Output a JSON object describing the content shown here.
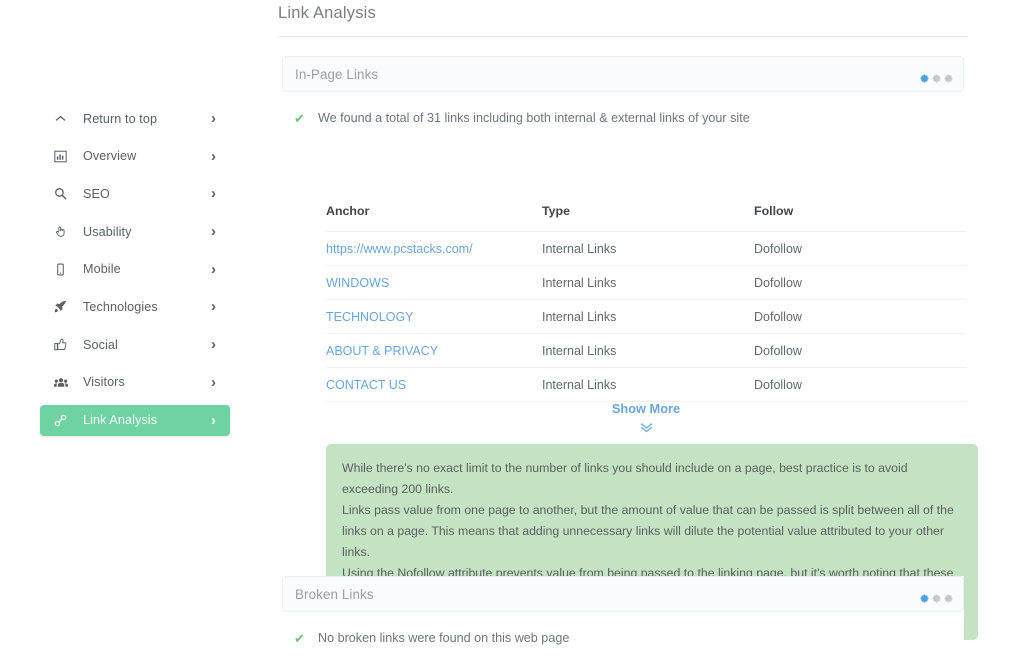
{
  "page": {
    "title": "Link Analysis"
  },
  "sidebar": {
    "items": [
      {
        "label": "Return to top",
        "icon": "chevron-up-icon",
        "key": "return-to-top",
        "active": false,
        "arrow": "›"
      },
      {
        "label": "Overview",
        "icon": "bar-chart-icon",
        "key": "overview",
        "active": false,
        "arrow": "›"
      },
      {
        "label": "SEO",
        "icon": "search-icon",
        "key": "seo",
        "active": false,
        "arrow": "›"
      },
      {
        "label": "Usability",
        "icon": "hand-pointer-icon",
        "key": "usability",
        "active": false,
        "arrow": "›"
      },
      {
        "label": "Mobile",
        "icon": "mobile-icon",
        "key": "mobile",
        "active": false,
        "arrow": "›"
      },
      {
        "label": "Technologies",
        "icon": "rocket-icon",
        "key": "technologies",
        "active": false,
        "arrow": "›"
      },
      {
        "label": "Social",
        "icon": "thumbs-up-icon",
        "key": "social",
        "active": false,
        "arrow": "›"
      },
      {
        "label": "Visitors",
        "icon": "users-icon",
        "key": "visitors",
        "active": false,
        "arrow": "›"
      },
      {
        "label": "Link Analysis",
        "icon": "chain-link-icon",
        "key": "link-analysis",
        "active": true,
        "arrow": "›"
      }
    ]
  },
  "inpage": {
    "header_title": "In-Page Links",
    "status_text": "We found a total of 31 links including both internal & external links of your site",
    "check_glyph": "✔",
    "columns": [
      "Anchor",
      "Type",
      "Follow"
    ],
    "rows": [
      {
        "anchor": "https://www.pcstacks.com/",
        "type": "Internal Links",
        "follow": "Dofollow"
      },
      {
        "anchor": "WINDOWS",
        "type": "Internal Links",
        "follow": "Dofollow"
      },
      {
        "anchor": "TECHNOLOGY",
        "type": "Internal Links",
        "follow": "Dofollow"
      },
      {
        "anchor": "ABOUT & PRIVACY",
        "type": "Internal Links",
        "follow": "Dofollow"
      },
      {
        "anchor": "CONTACT US",
        "type": "Internal Links",
        "follow": "Dofollow"
      }
    ],
    "show_more_label": "Show More",
    "show_more_chevron": "»",
    "note_paragraphs": [
      "While there's no exact limit to the number of links you should include on a page, best practice is to avoid exceeding 200 links.",
      "Links pass value from one page to another, but the amount of value that can be passed is split between all of the links on a page. This means that adding unnecessary links will dilute the potential value attributed to your other links.",
      "Using the Nofollow attribute prevents value from being passed to the linking page, but it's worth noting that these links are still taken into account when calculating the value that is passed through each link, so Nofollow links can also dilute pagerank."
    ]
  },
  "broken": {
    "header_title": "Broken Links",
    "status_text": "No broken links were found on this web page",
    "check_glyph": "✔"
  },
  "colors": {
    "accent_green": "#6ed3a0",
    "note_green": "#c3e3c2",
    "link_blue": "#6aa5dd",
    "gear_active": "#4a9fe0",
    "gear_idle": "#bfc4c9",
    "check_green": "#6fc36f",
    "card_header_bg": "#fafbfc",
    "text_muted": "#9aa0a6"
  }
}
